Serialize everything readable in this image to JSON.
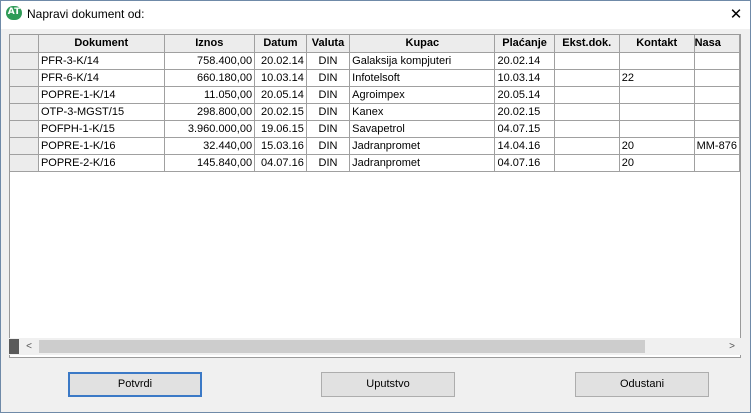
{
  "window": {
    "title": "Napravi dokument od:",
    "app_icon_text": "AT",
    "close_glyph": "✕"
  },
  "table": {
    "columns": [
      "Dokument",
      "Iznos",
      "Datum",
      "Valuta",
      "Kupac",
      "Plaćanje",
      "Ekst.dok.",
      "Kontakt",
      "Nasa"
    ],
    "rows": [
      [
        "PFR-3-K/14",
        "758.400,00",
        "20.02.14",
        "DIN",
        "Galaksija kompjuteri",
        "20.02.14",
        "",
        "",
        ""
      ],
      [
        "PFR-6-K/14",
        "660.180,00",
        "10.03.14",
        "DIN",
        "Infotelsoft",
        "10.03.14",
        "",
        "22",
        ""
      ],
      [
        "POPRE-1-K/14",
        "11.050,00",
        "20.05.14",
        "DIN",
        "Agroimpex",
        "20.05.14",
        "",
        "",
        ""
      ],
      [
        "OTP-3-MGST/15",
        "298.800,00",
        "20.02.15",
        "DIN",
        "Kanex",
        "20.02.15",
        "",
        "",
        ""
      ],
      [
        "POFPH-1-K/15",
        "3.960.000,00",
        "19.06.15",
        "DIN",
        "Savapetrol",
        "04.07.15",
        "",
        "",
        ""
      ],
      [
        "POPRE-1-K/16",
        "32.440,00",
        "15.03.16",
        "DIN",
        "Jadranpromet",
        "14.04.16",
        "",
        "20",
        "MM-876"
      ],
      [
        "POPRE-2-K/16",
        "145.840,00",
        "04.07.16",
        "DIN",
        "Jadranpromet",
        "04.07.16",
        "",
        "20",
        ""
      ]
    ]
  },
  "scrollbar": {
    "left_arrow": "<",
    "right_arrow": ">"
  },
  "buttons": {
    "confirm": "Potvrdi",
    "instructions": "Uputstvo",
    "cancel": "Odustani"
  }
}
